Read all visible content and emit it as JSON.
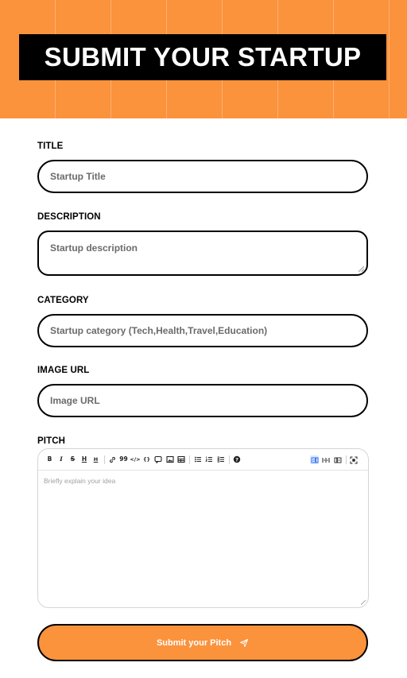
{
  "hero": {
    "title": "SUBMIT YOUR STARTUP"
  },
  "form": {
    "title": {
      "label": "TITLE",
      "placeholder": "Startup Title"
    },
    "description": {
      "label": "DESCRIPTION",
      "placeholder": "Startup description"
    },
    "category": {
      "label": "CATEGORY",
      "placeholder": "Startup category (Tech,Health,Travel,Education)"
    },
    "image_url": {
      "label": "IMAGE URL",
      "placeholder": "Image URL"
    },
    "pitch": {
      "label": "PITCH",
      "placeholder": "Briefly explain your idea",
      "toolbar": {
        "bold": "B",
        "italic": "I",
        "strikethrough": "S",
        "heading1": "H",
        "heading2": "H",
        "link": "link-icon",
        "quote": "99",
        "code": "</>",
        "code_block": "{}",
        "comment": "comment-icon",
        "image": "image-icon",
        "table": "table-icon",
        "unordered_list": "ul",
        "ordered_list": "ol",
        "checklist": "check-list",
        "help": "?",
        "edit_mode": "edit",
        "live_mode": "live",
        "preview_mode": "preview",
        "fullscreen": "fullscreen"
      }
    },
    "submit_label": "Submit your Pitch"
  },
  "colors": {
    "accent": "#fb923c",
    "dark": "#000000"
  }
}
